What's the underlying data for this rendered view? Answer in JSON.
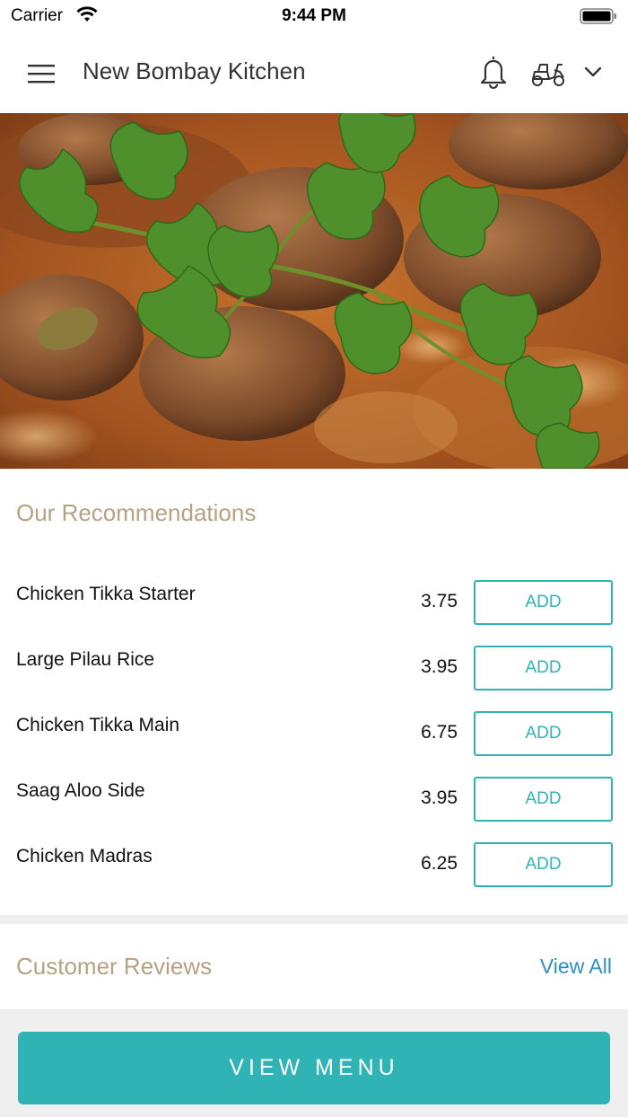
{
  "status_bar": {
    "carrier": "Carrier",
    "time": "9:44 PM"
  },
  "nav": {
    "title": "New Bombay Kitchen",
    "icons": [
      "menu-icon",
      "bell-icon",
      "scooter-icon",
      "chevron-down-icon"
    ]
  },
  "hero": {
    "image": "curry-with-coriander-photo"
  },
  "recommendations": {
    "heading": "Our Recommendations",
    "items": [
      {
        "name": "Chicken Tikka Starter",
        "price": "3.75",
        "action": "ADD"
      },
      {
        "name": "Large Pilau Rice",
        "price": "3.95",
        "action": "ADD"
      },
      {
        "name": "Chicken Tikka Main",
        "price": "6.75",
        "action": "ADD"
      },
      {
        "name": "Saag Aloo Side",
        "price": "3.95",
        "action": "ADD"
      },
      {
        "name": "Chicken Madras",
        "price": "6.25",
        "action": "ADD"
      }
    ]
  },
  "reviews": {
    "heading": "Customer Reviews",
    "view_all": "View All"
  },
  "footer": {
    "view_menu": "VIEW MENU"
  },
  "colors": {
    "accent": "#2fb3b5",
    "heading": "#b5a282",
    "link": "#2a90c0"
  }
}
